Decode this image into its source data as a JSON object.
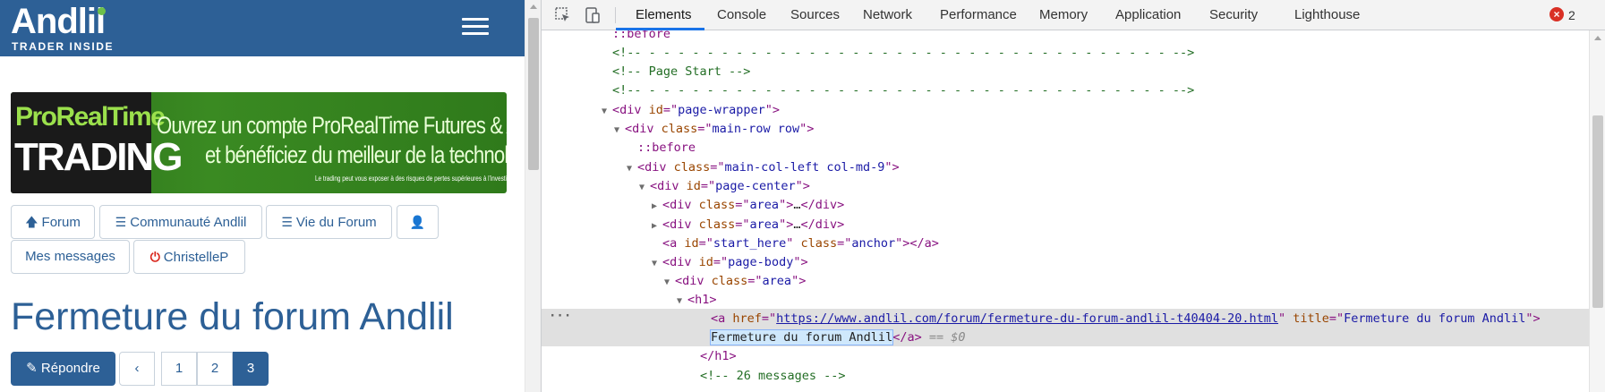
{
  "site": {
    "logo_text": "Andlil",
    "logo_tagline": "TRADER INSIDE",
    "banner": {
      "brand_top": "ProRealTime",
      "brand_bottom": "TRADING",
      "line1": "Ouvrez un compte ProRealTime Futures & Actions",
      "line2": "et bénéficiez du meilleur de la technologie",
      "disclaimer": "Le trading peut vous exposer à des risques de pertes supérieures à l'investissement initial."
    },
    "nav": {
      "forum": "Forum",
      "communaute": "Communauté Andlil",
      "vie_forum": "Vie du Forum",
      "messages": "Mes messages",
      "user": "ChristelleP"
    },
    "thread_title": "Fermeture du forum Andlil",
    "reply_label": "Répondre",
    "pagination": {
      "prev": "‹",
      "pages": [
        "1",
        "2",
        "3"
      ],
      "active": "3"
    },
    "colors": {
      "brand_blue": "#2d6096",
      "logout_red": "#d9261c",
      "green_dot": "#6cc04a"
    }
  },
  "devtools": {
    "tabs": [
      "Elements",
      "Console",
      "Sources",
      "Network",
      "Performance",
      "Memory",
      "Application",
      "Security",
      "Lighthouse"
    ],
    "active_tab": "Elements",
    "error_count": "2",
    "dom": {
      "before": "::before",
      "comment_dashes": "<!-- - - - - - - - - - - - - - - - - - - - - - - - - - - - - - - - - - - - - -->",
      "comment_page_start": "<!-- Page Start -->",
      "page_wrapper_id": "page-wrapper",
      "main_row_class": "main-row row",
      "main_col_class": "main-col-left col-md-9",
      "page_center_id": "page-center",
      "area_class": "area",
      "anchor_id": "start_here",
      "anchor_class": "anchor",
      "page_body_id": "page-body",
      "h1": "h1",
      "link_href": "https://www.andlil.com/forum/fermeture-du-forum-andlil-t40404-20.html",
      "link_title": "Fermeture du forum Andlil",
      "link_text": "Fermeture du forum Andlil",
      "eq_dollar": "== $0",
      "comment_26": "<!-- 26 messages -->"
    }
  }
}
